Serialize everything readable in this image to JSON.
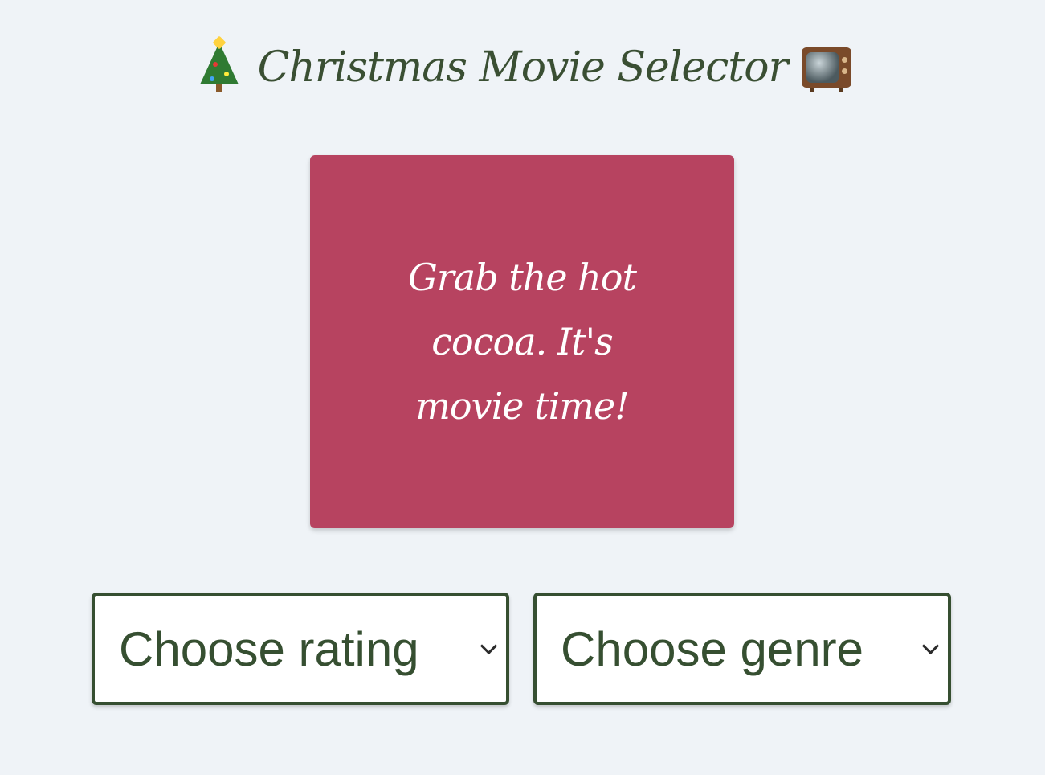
{
  "header": {
    "title": "Christmas Movie Selector",
    "left_icon": "christmas-tree-icon",
    "right_icon": "television-icon"
  },
  "card": {
    "message": "Grab the hot cocoa. It's movie time!",
    "color": "#b74360"
  },
  "filters": {
    "rating": {
      "selected": "Choose rating"
    },
    "genre": {
      "selected": "Choose genre"
    }
  },
  "colors": {
    "background": "#eff3f7",
    "accent": "#364f31",
    "card": "#b74360"
  }
}
